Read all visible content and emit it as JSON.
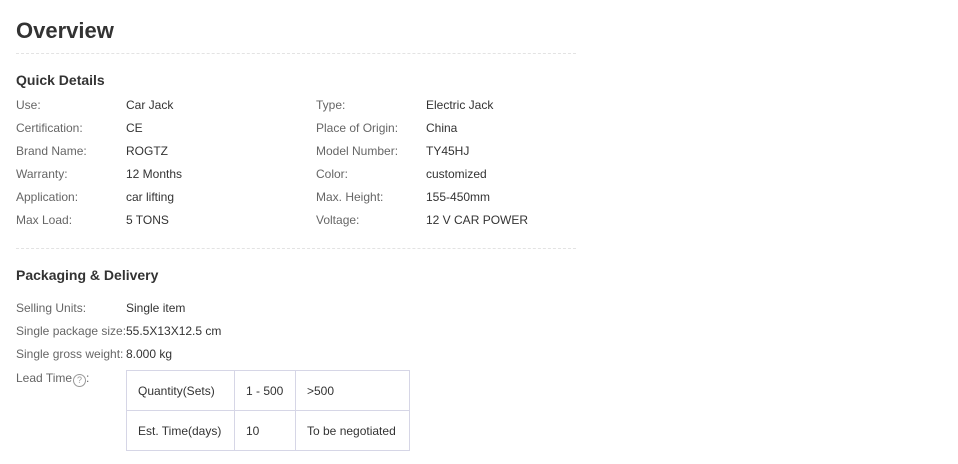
{
  "overview": {
    "title": "Overview"
  },
  "quick_details": {
    "title": "Quick Details",
    "left": [
      {
        "key": "Use:",
        "value": "Car Jack"
      },
      {
        "key": "Certification:",
        "value": "CE"
      },
      {
        "key": "Brand Name:",
        "value": "ROGTZ"
      },
      {
        "key": "Warranty:",
        "value": "12 Months"
      },
      {
        "key": "Application:",
        "value": "car lifting"
      },
      {
        "key": "Max Load:",
        "value": "5 TONS"
      }
    ],
    "right": [
      {
        "key": "Type:",
        "value": "Electric Jack"
      },
      {
        "key": "Place of Origin:",
        "value": "China"
      },
      {
        "key": "Model Number:",
        "value": "TY45HJ"
      },
      {
        "key": "Color:",
        "value": "customized"
      },
      {
        "key": "Max. Height:",
        "value": "155-450mm"
      },
      {
        "key": "Voltage:",
        "value": "12 V CAR POWER"
      }
    ]
  },
  "packaging": {
    "title": "Packaging & Delivery",
    "rows": [
      {
        "key": "Selling Units:",
        "value": "Single item"
      },
      {
        "key": "Single package size:",
        "value": "55.5X13X12.5 cm"
      },
      {
        "key": "Single gross weight:",
        "value": "8.000 kg"
      }
    ],
    "lead_time_label": "Lead Time",
    "help_icon_glyph": "?",
    "lead_table": [
      [
        "Quantity(Sets)",
        "1 - 500",
        ">500"
      ],
      [
        "Est. Time(days)",
        "10",
        "To be negotiated"
      ]
    ]
  }
}
